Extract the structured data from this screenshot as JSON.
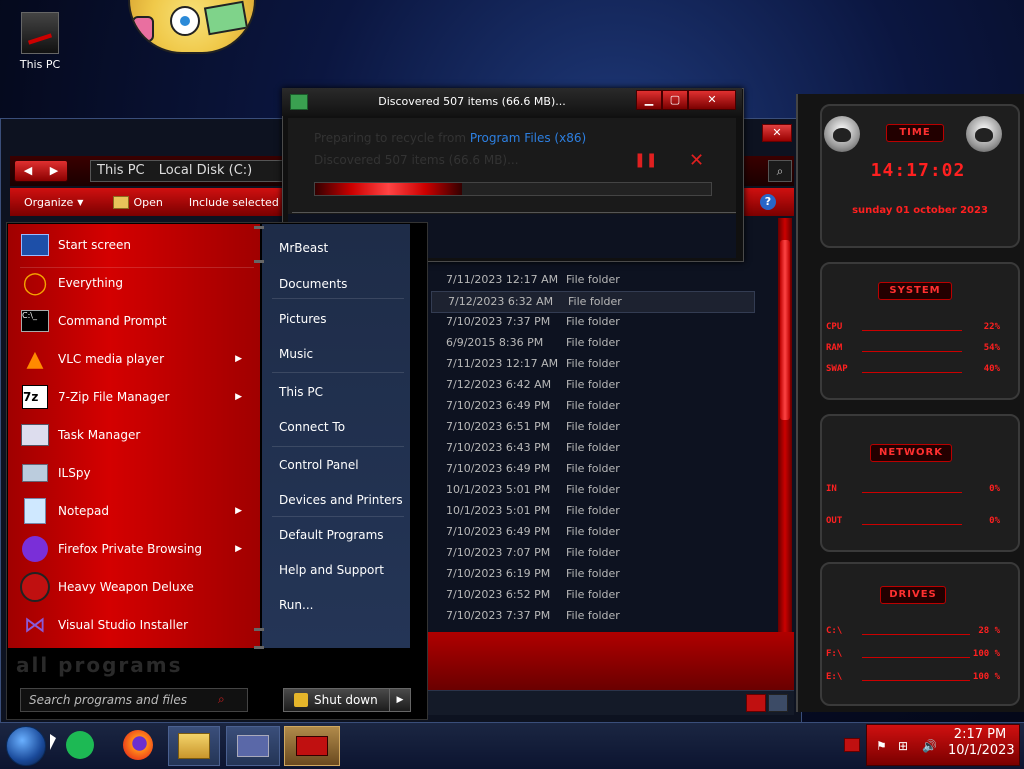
{
  "desktop": {
    "icon_label": "This PC"
  },
  "explorer": {
    "address": [
      "This PC",
      "Local Disk (C:)"
    ],
    "toolbar": {
      "organize": "Organize",
      "open": "Open",
      "include": "Include selected fol"
    },
    "rows": [
      {
        "date": "7/11/2023 12:17 AM",
        "type": "File folder"
      },
      {
        "date": "7/12/2023 6:32 AM",
        "type": "File folder"
      },
      {
        "date": "7/10/2023 7:37 PM",
        "type": "File folder"
      },
      {
        "date": "6/9/2015 8:36 PM",
        "type": "File folder"
      },
      {
        "date": "7/11/2023 12:17 AM",
        "type": "File folder"
      },
      {
        "date": "7/12/2023 6:42 AM",
        "type": "File folder"
      },
      {
        "date": "7/10/2023 6:49 PM",
        "type": "File folder"
      },
      {
        "date": "7/10/2023 6:51 PM",
        "type": "File folder"
      },
      {
        "date": "7/10/2023 6:43 PM",
        "type": "File folder"
      },
      {
        "date": "7/10/2023 6:49 PM",
        "type": "File folder"
      },
      {
        "date": "10/1/2023 5:01 PM",
        "type": "File folder"
      },
      {
        "date": "10/1/2023 5:01 PM",
        "type": "File folder"
      },
      {
        "date": "7/10/2023 6:49 PM",
        "type": "File folder"
      },
      {
        "date": "7/10/2023 7:07 PM",
        "type": "File folder"
      },
      {
        "date": "7/10/2023 6:19 PM",
        "type": "File folder"
      },
      {
        "date": "7/10/2023 6:52 PM",
        "type": "File folder"
      },
      {
        "date": "7/10/2023 7:37 PM",
        "type": "File folder"
      }
    ]
  },
  "dialog": {
    "title": "Discovered 507 items (66.6 MB)...",
    "line1_prefix": "Preparing to recycle from ",
    "line1_link": "Program Files (x86)",
    "line2": "Discovered 507 items (66.6 MB)...",
    "progress_percent": 37
  },
  "start_menu": {
    "programs": [
      {
        "label": "Start screen",
        "icon": "start-screen-icon",
        "arrow": false
      },
      {
        "label": "Everything",
        "icon": "magnifier-icon",
        "arrow": false
      },
      {
        "label": "Command Prompt",
        "icon": "terminal-icon",
        "arrow": false
      },
      {
        "label": "VLC media player",
        "icon": "traffic-cone-icon",
        "arrow": true
      },
      {
        "label": "7-Zip File Manager",
        "icon": "7zip-icon",
        "arrow": true
      },
      {
        "label": "Task Manager",
        "icon": "monitor-chart-icon",
        "arrow": false
      },
      {
        "label": "ILSpy",
        "icon": "ilspy-icon",
        "arrow": false
      },
      {
        "label": "Notepad",
        "icon": "notepad-icon",
        "arrow": true
      },
      {
        "label": "Firefox Private Browsing",
        "icon": "private-mask-icon",
        "arrow": true
      },
      {
        "label": "Heavy Weapon Deluxe",
        "icon": "radiation-icon",
        "arrow": false
      },
      {
        "label": "Visual Studio Installer",
        "icon": "visual-studio-icon",
        "arrow": false
      }
    ],
    "right": [
      "MrBeast",
      "Documents",
      "Pictures",
      "Music",
      "This PC",
      "Connect To",
      "Control Panel",
      "Devices and Printers",
      "Default Programs",
      "Help and Support",
      "Run..."
    ],
    "all_programs": "all programs",
    "search_placeholder": "Search programs and files",
    "shutdown": "Shut down"
  },
  "gadget": {
    "time_title": "TIME",
    "clock": "14:17:02",
    "date": "sunday 01 october 2023",
    "system_title": "SYSTEM",
    "system": [
      {
        "label": "CPU",
        "value": "22%"
      },
      {
        "label": "RAM",
        "value": "54%"
      },
      {
        "label": "SWAP",
        "value": "40%"
      }
    ],
    "network_title": "NETWORK",
    "network": [
      {
        "label": "IN",
        "value": "0%"
      },
      {
        "label": "OUT",
        "value": "0%"
      }
    ],
    "drives_title": "DRIVES",
    "drives": [
      {
        "label": "C:\\",
        "value": "28 %"
      },
      {
        "label": "F:\\",
        "value": "100 %"
      },
      {
        "label": "E:\\",
        "value": "100 %"
      }
    ]
  },
  "taskbar": {
    "time": "2:17 PM",
    "date": "10/1/2023"
  },
  "colors": {
    "accent_red": "#d40000",
    "panel_blue": "#243556",
    "clock_red": "#ff2020"
  }
}
